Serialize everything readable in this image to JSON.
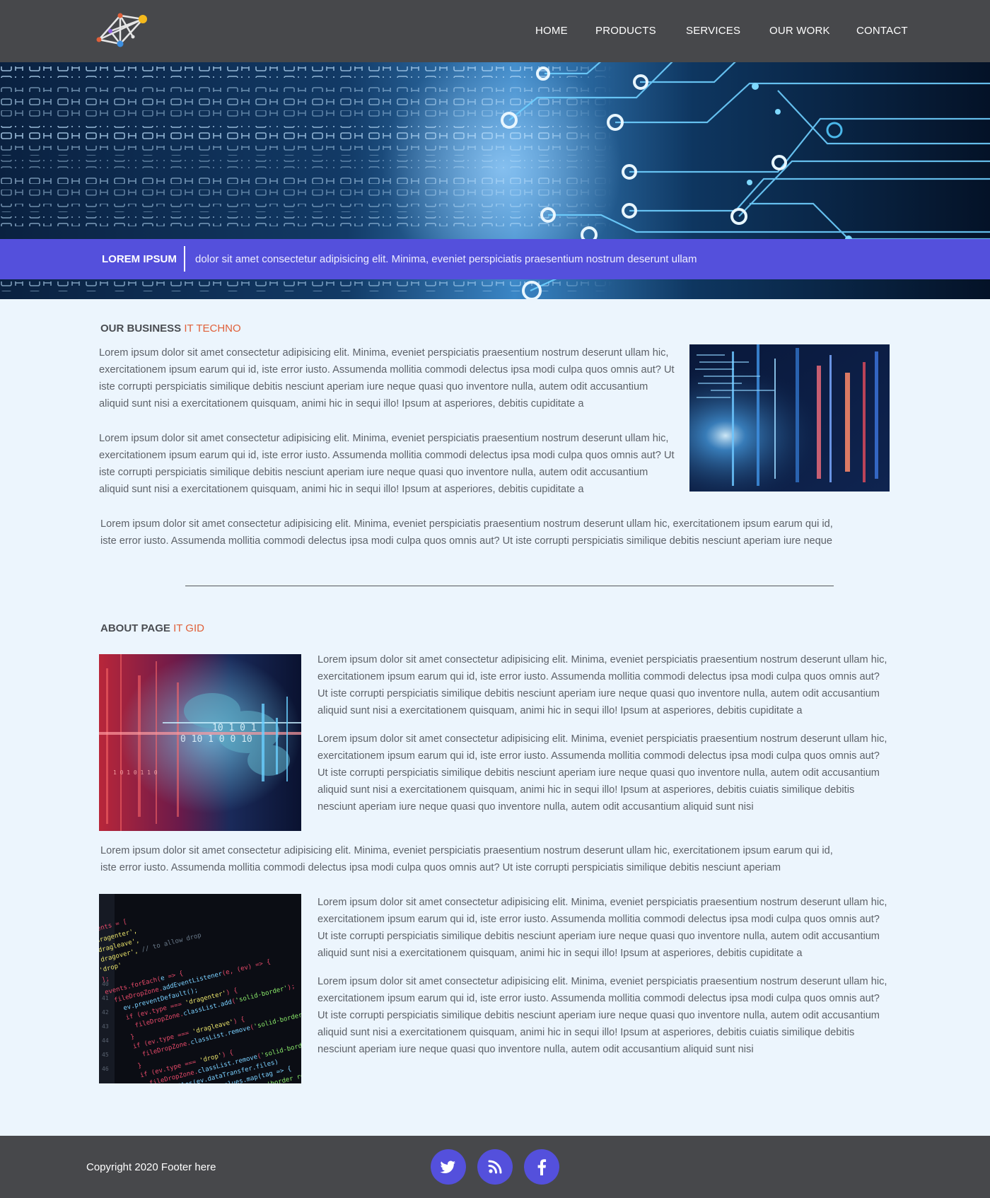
{
  "nav": {
    "items": [
      {
        "label": "HOME"
      },
      {
        "label": "PRODUCTS"
      },
      {
        "label": "SERVICES"
      },
      {
        "label": "OUR WORK"
      },
      {
        "label": "CONTACT"
      }
    ]
  },
  "banner": {
    "title": "LOREM IPSUM",
    "text": "dolor sit amet consectetur adipisicing elit. Minima, eveniet perspiciatis praesentium nostrum deserunt ullam"
  },
  "business": {
    "heading": "OUR BUSINESS",
    "heading_accent": "IT TECHNO",
    "paragraphs": [
      "Lorem ipsum dolor sit amet consectetur adipisicing elit. Minima, eveniet perspiciatis praesentium nostrum deserunt ullam hic, exercitationem ipsum earum qui id, iste error iusto. Assumenda mollitia commodi delectus ipsa modi culpa quos omnis aut? Ut iste corrupti perspiciatis similique debitis nesciunt aperiam iure neque quasi quo inventore nulla, autem odit accusantium aliquid sunt nisi a exercitationem quisquam, animi hic in sequi illo! Ipsum at asperiores, debitis cupiditate a",
      "Lorem ipsum dolor sit amet consectetur adipisicing elit. Minima, eveniet perspiciatis praesentium nostrum deserunt ullam hic, exercitationem ipsum earum qui id, iste error iusto. Assumenda mollitia commodi delectus ipsa modi culpa quos omnis aut? Ut iste corrupti perspiciatis similique debitis nesciunt aperiam iure neque quasi quo inventore nulla, autem odit accusantium aliquid sunt nisi a exercitationem quisquam, animi hic in sequi illo! Ipsum at asperiores, debitis cupiditate a",
      "Lorem ipsum dolor sit amet consectetur adipisicing elit. Minima, eveniet perspiciatis praesentium nostrum deserunt ullam hic, exercitationem ipsum earum qui id, iste error iusto. Assumenda mollitia commodi delectus ipsa modi culpa quos omnis aut? Ut iste corrupti perspiciatis similique debitis nesciunt aperiam iure neque"
    ]
  },
  "about": {
    "heading": "ABOUT PAGE",
    "heading_accent": "IT GID",
    "block1": [
      "Lorem ipsum dolor sit amet consectetur adipisicing elit. Minima, eveniet perspiciatis praesentium nostrum deserunt ullam hic, exercitationem ipsum earum qui id, iste error iusto. Assumenda mollitia commodi delectus ipsa modi culpa quos omnis aut? Ut iste corrupti perspiciatis similique debitis nesciunt aperiam iure neque quasi quo inventore nulla, autem odit accusantium aliquid sunt nisi a exercitationem quisquam, animi hic in sequi illo! Ipsum at asperiores, debitis cupiditate a",
      "Lorem ipsum dolor sit amet consectetur adipisicing elit. Minima, eveniet perspiciatis praesentium nostrum deserunt ullam hic, exercitationem ipsum earum qui id, iste error iusto. Assumenda mollitia commodi delectus ipsa modi culpa quos omnis aut? Ut iste corrupti perspiciatis similique debitis nesciunt aperiam iure neque quasi quo inventore nulla, autem odit accusantium aliquid sunt nisi a exercitationem quisquam, animi hic in sequi illo! Ipsum at asperiores, debitis cuiatis similique debitis nesciunt aperiam iure neque quasi quo inventore nulla, autem odit accusantium aliquid sunt nisi"
    ],
    "middle": "Lorem ipsum dolor sit amet consectetur adipisicing elit. Minima, eveniet perspiciatis praesentium nostrum deserunt ullam hic, exercitationem ipsum earum qui id, iste error iusto. Assumenda mollitia commodi delectus ipsa modi culpa quos omnis aut? Ut iste corrupti perspiciatis similique debitis nesciunt aperiam",
    "block2": [
      "Lorem ipsum dolor sit amet consectetur adipisicing elit. Minima, eveniet perspiciatis praesentium nostrum deserunt ullam hic, exercitationem ipsum earum qui id, iste error iusto. Assumenda mollitia commodi delectus ipsa modi culpa quos omnis aut? Ut iste corrupti perspiciatis similique debitis nesciunt aperiam iure neque quasi quo inventore nulla, autem odit accusantium aliquid sunt nisi a exercitationem quisquam, animi hic in sequi illo! Ipsum at asperiores, debitis cupiditate a",
      "Lorem ipsum dolor sit amet consectetur adipisicing elit. Minima, eveniet perspiciatis praesentium nostrum deserunt ullam hic, exercitationem ipsum earum qui id, iste error iusto. Assumenda mollitia commodi delectus ipsa modi culpa quos omnis aut? Ut iste corrupti perspiciatis similique debitis nesciunt aperiam iure neque quasi quo inventore nulla, autem odit accusantium aliquid sunt nisi a exercitationem quisquam, animi hic in sequi illo! Ipsum at asperiores, debitis cuiatis similique debitis nesciunt aperiam iure neque quasi quo inventore nulla, autem odit accusantium aliquid sunt nisi"
    ]
  },
  "footer": {
    "copyright": "Copyright 2020 Footer here",
    "social": [
      {
        "icon": "twitter-icon"
      },
      {
        "icon": "rss-icon"
      },
      {
        "icon": "facebook-icon"
      }
    ]
  },
  "colors": {
    "header_bg": "#47484b",
    "accent_purple": "#5450dc",
    "accent_orange": "#e0603a",
    "page_bg": "#ecf5fd"
  }
}
